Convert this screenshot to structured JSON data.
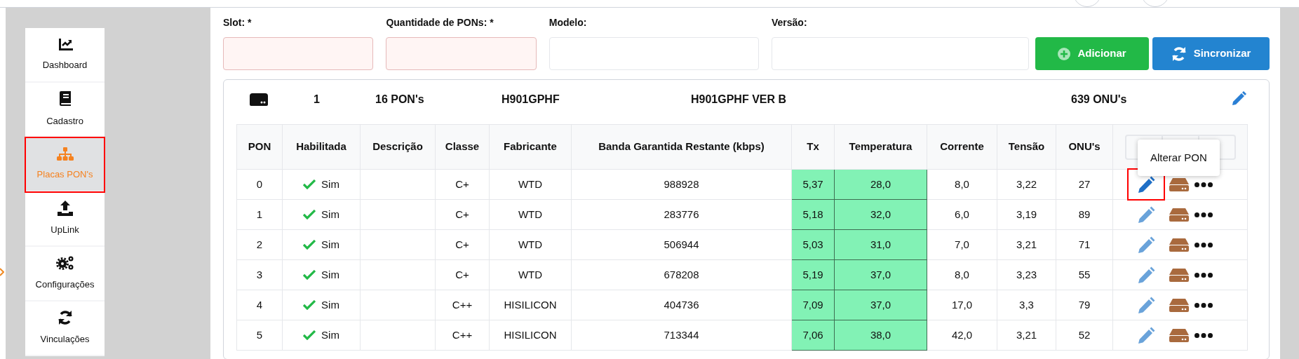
{
  "sidebar": {
    "items": [
      {
        "label": "Dashboard",
        "selected": false
      },
      {
        "label": "Cadastro",
        "selected": false
      },
      {
        "label": "Placas PON's",
        "selected": true
      },
      {
        "label": "UpLink",
        "selected": false
      },
      {
        "label": "Configurações",
        "selected": false
      },
      {
        "label": "Vinculações",
        "selected": false
      }
    ]
  },
  "form": {
    "fields": [
      {
        "label": "Slot: *",
        "required": true
      },
      {
        "label": "Quantidade de PONs: *",
        "required": true
      },
      {
        "label": "Modelo:",
        "required": false
      },
      {
        "label": "Versão:",
        "required": false
      }
    ],
    "buttons": [
      {
        "label": "Adicionar",
        "kind": "add"
      },
      {
        "label": "Sincronizar",
        "kind": "sync"
      }
    ]
  },
  "board": {
    "slot": "1",
    "pons": "16 PON's",
    "model": "H901GPHF",
    "version": "H901GPHF VER B",
    "onus": "639 ONU's"
  },
  "table": {
    "columns": [
      "PON",
      "Habilitada",
      "Descrição",
      "Classe",
      "Fabricante",
      "Banda Garantida Restante (kbps)",
      "Tx",
      "Temperatura",
      "Corrente",
      "Tensão",
      "ONU's"
    ],
    "rows": [
      {
        "pon": "0",
        "enabled": true,
        "enabled_label": "Sim",
        "class": "C+",
        "manufacturer": "WTD",
        "band": "988928",
        "tx": "5,37",
        "temperature": "28,0",
        "current": "8,0",
        "voltage": "3,22",
        "onus": "27",
        "selected": true
      },
      {
        "pon": "1",
        "enabled": true,
        "enabled_label": "Sim",
        "class": "C+",
        "manufacturer": "WTD",
        "band": "283776",
        "tx": "5,18",
        "temperature": "32,0",
        "current": "6,0",
        "voltage": "3,19",
        "onus": "89",
        "selected": false
      },
      {
        "pon": "2",
        "enabled": true,
        "enabled_label": "Sim",
        "class": "C+",
        "manufacturer": "WTD",
        "band": "506944",
        "tx": "5,03",
        "temperature": "31,0",
        "current": "7,0",
        "voltage": "3,21",
        "onus": "71",
        "selected": false
      },
      {
        "pon": "3",
        "enabled": true,
        "enabled_label": "Sim",
        "class": "C+",
        "manufacturer": "WTD",
        "band": "678208",
        "tx": "5,19",
        "temperature": "37,0",
        "current": "8,0",
        "voltage": "3,23",
        "onus": "55",
        "selected": false
      },
      {
        "pon": "4",
        "enabled": true,
        "enabled_label": "Sim",
        "class": "C++",
        "manufacturer": "HISILICON",
        "band": "404736",
        "tx": "7,09",
        "temperature": "37,0",
        "current": "17,0",
        "voltage": "3,3",
        "onus": "79",
        "selected": false
      },
      {
        "pon": "5",
        "enabled": true,
        "enabled_label": "Sim",
        "class": "C++",
        "manufacturer": "HISILICON",
        "band": "713344",
        "tx": "7,06",
        "temperature": "38,0",
        "current": "42,0",
        "voltage": "3,21",
        "onus": "52",
        "selected": false
      }
    ]
  },
  "tooltip": {
    "text": "Alterar PON"
  }
}
